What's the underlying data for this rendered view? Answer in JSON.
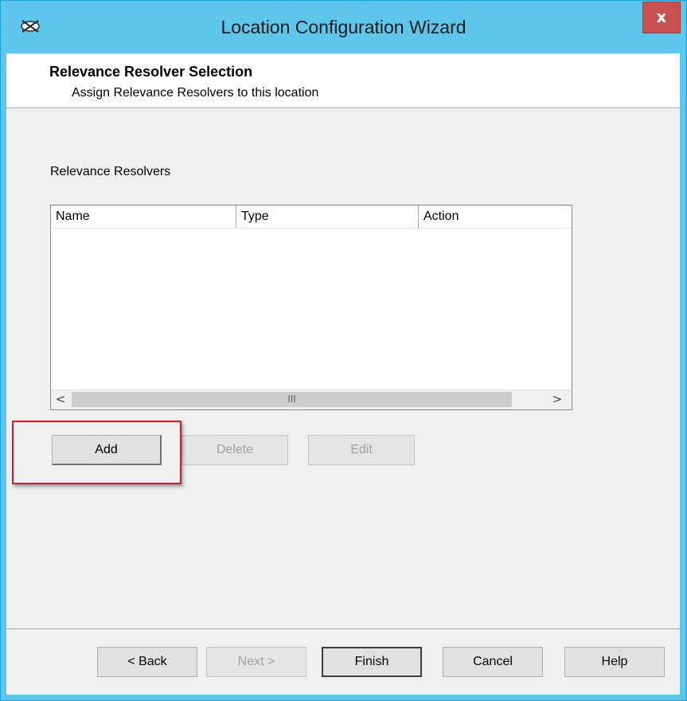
{
  "window": {
    "title": "Location Configuration Wizard",
    "close_glyph": "x"
  },
  "header": {
    "title": "Relevance Resolver Selection",
    "subtitle": "Assign Relevance Resolvers to this location"
  },
  "section": {
    "label": "Relevance Resolvers"
  },
  "table": {
    "columns": [
      "Name",
      "Type",
      "Action"
    ],
    "rows": [],
    "scrollbar": {
      "left_arrow": "<",
      "right_arrow": ">",
      "grip": "III"
    }
  },
  "actions": {
    "add": "Add",
    "delete": "Delete",
    "edit": "Edit"
  },
  "footer": {
    "back": "< Back",
    "next": "Next >",
    "finish": "Finish",
    "cancel": "Cancel",
    "help": "Help"
  },
  "colors": {
    "titlebar": "#5dc6ea",
    "close": "#c75050",
    "highlight": "#c7202a"
  },
  "icons": {
    "app": "atmosphere-app-icon"
  }
}
